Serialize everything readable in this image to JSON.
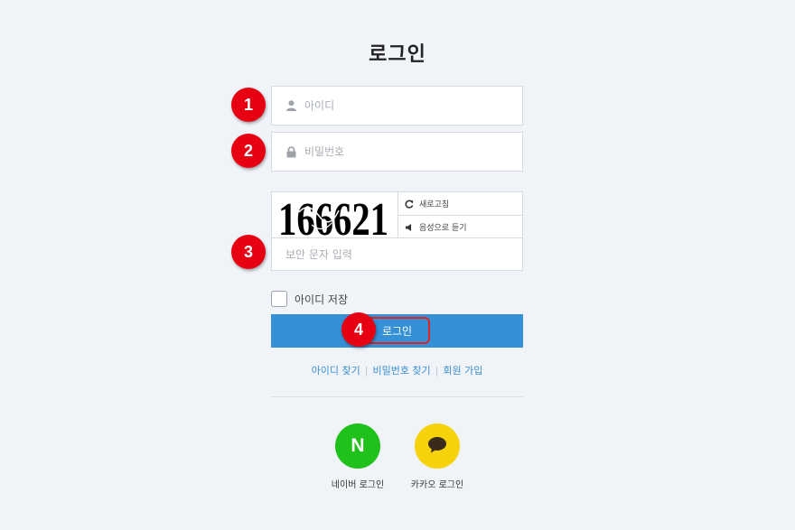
{
  "page": {
    "title": "로그인"
  },
  "login_form": {
    "id_placeholder": "아이디",
    "password_placeholder": "비밀번호",
    "captcha": {
      "code": "166621",
      "refresh_label": "새로고침",
      "audio_label": "음성으로 듣기"
    },
    "security_placeholder": "보안 문자 입력",
    "remember_label": "아이디 저장",
    "remember_checked": false,
    "login_button": "로그인"
  },
  "links": {
    "find_id": "아이디 찾기",
    "find_password": "비밀번호 찾기",
    "signup": "회원 가입",
    "separator": "|"
  },
  "social": {
    "naver_label": "네이버 로그인",
    "naver_logo": "N",
    "kakao_label": "카카오 로그인"
  },
  "annotations": {
    "badge_1": "1",
    "badge_2": "2",
    "badge_3": "3",
    "badge_4": "4"
  },
  "colors": {
    "background": "#f0f3f8",
    "primary": "#3590d6",
    "link": "#3a8fd1",
    "naver": "#20c11a",
    "kakao": "#f5d20a",
    "badge": "#e60012"
  }
}
